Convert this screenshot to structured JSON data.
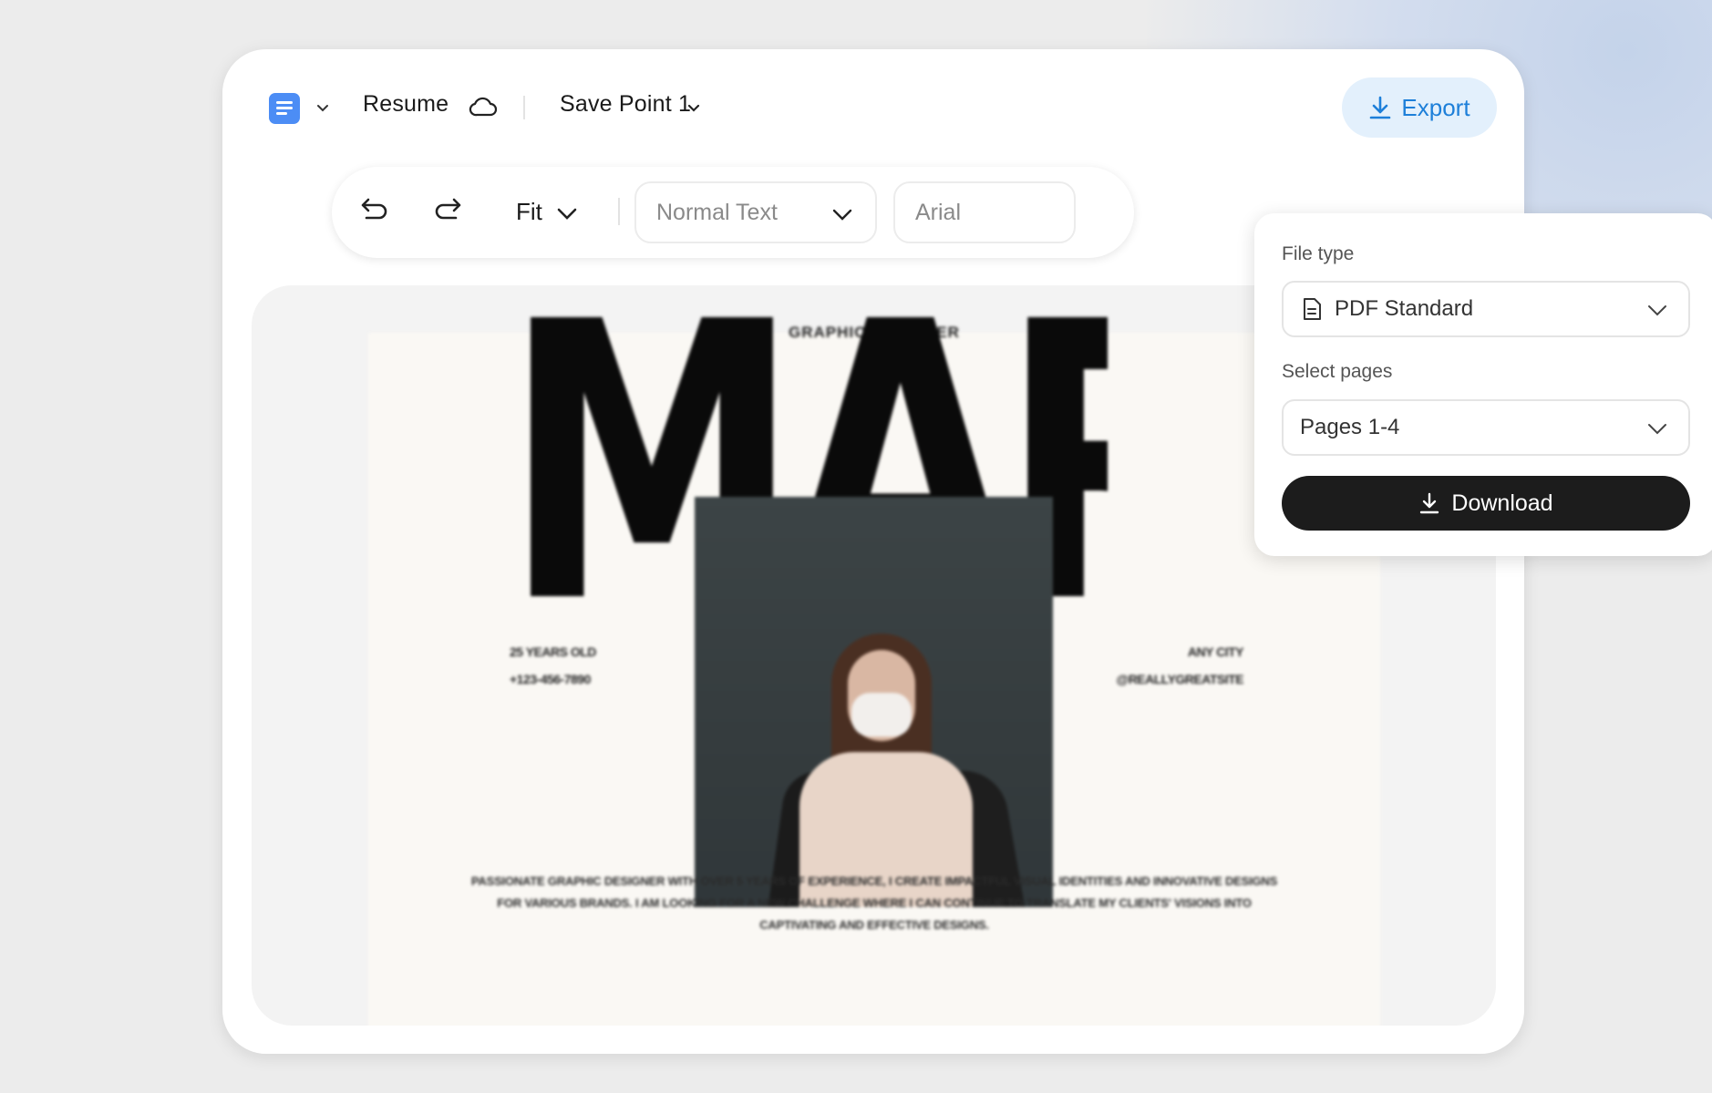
{
  "topbar": {
    "doc_title": "Resume",
    "save_point": "Save Point 1",
    "export_label": "Export"
  },
  "toolbar": {
    "zoom_label": "Fit",
    "text_style": "Normal Text",
    "font_family": "Arial"
  },
  "document": {
    "role": "GRAPHIC DESIGNER",
    "name_display": "MARIE",
    "age": "25 YEARS OLD",
    "phone": "+123-456-7890",
    "city": "ANY CITY",
    "handle": "@REALLYGREATSITE",
    "bio": "PASSIONATE GRAPHIC DESIGNER WITH OVER 5 YEARS OF EXPERIENCE, I CREATE IMPACTFUL VISUAL IDENTITIES AND INNOVATIVE DESIGNS FOR VARIOUS BRANDS. I AM LOOKING FOR A NEW CHALLENGE WHERE I CAN CONTINUE TO TRANSLATE MY CLIENTS' VISIONS INTO CAPTIVATING AND EFFECTIVE DESIGNS."
  },
  "export_panel": {
    "file_type_label": "File type",
    "file_type_value": "PDF Standard",
    "pages_label": "Select pages",
    "pages_value": "Pages 1-4",
    "download_label": "Download"
  },
  "colors": {
    "accent_blue": "#1d7fd9",
    "export_bg": "#e3f0fc",
    "doc_icon": "#4c8df5",
    "download_bg": "#1c1c1c"
  },
  "icons": [
    "document-icon",
    "chevron-down-icon",
    "cloud-icon",
    "download-icon",
    "undo-icon",
    "redo-icon",
    "pdf-file-icon"
  ]
}
